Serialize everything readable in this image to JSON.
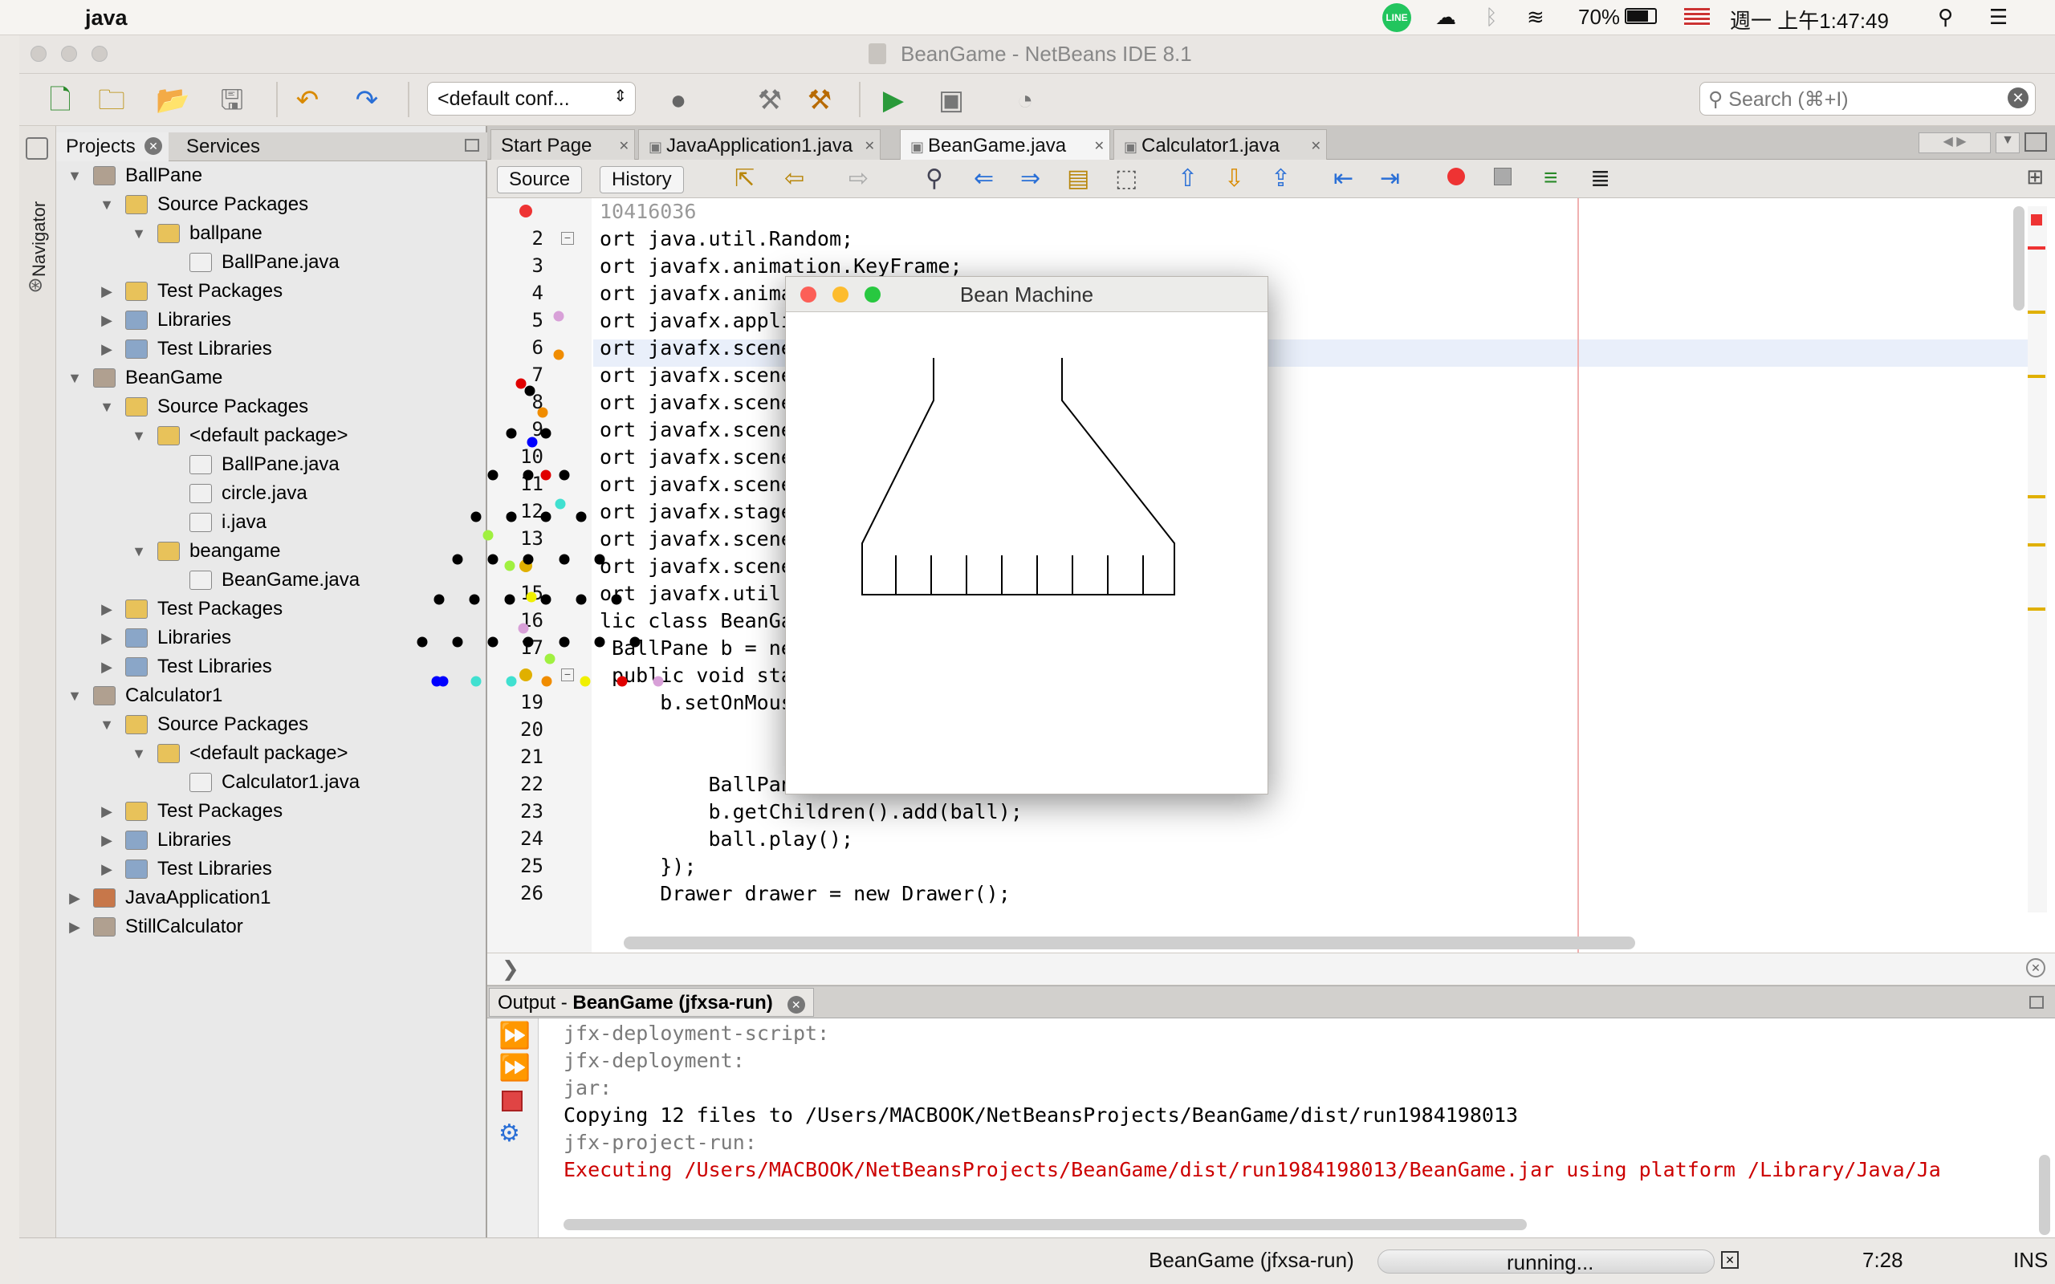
{
  "menubar": {
    "app": "java",
    "battery": "70%",
    "clock": "週一 上午1:47:49"
  },
  "window": {
    "title": "BeanGame - NetBeans IDE 8.1"
  },
  "toolbar": {
    "config": "<default conf...",
    "search_placeholder": "Search (⌘+I)"
  },
  "navigator": {
    "label": "Navigator"
  },
  "projects": {
    "tab_projects": "Projects",
    "tab_services": "Services",
    "tree": [
      {
        "label": "BallPane",
        "depth": 0,
        "icon": "project",
        "open": true
      },
      {
        "label": "Source Packages",
        "depth": 1,
        "icon": "srcpkg",
        "open": true
      },
      {
        "label": "ballpane",
        "depth": 2,
        "icon": "package",
        "open": true
      },
      {
        "label": "BallPane.java",
        "depth": 3,
        "icon": "java"
      },
      {
        "label": "Test Packages",
        "depth": 1,
        "icon": "srcpkg",
        "open": false
      },
      {
        "label": "Libraries",
        "depth": 1,
        "icon": "library",
        "open": false
      },
      {
        "label": "Test Libraries",
        "depth": 1,
        "icon": "library",
        "open": false
      },
      {
        "label": "BeanGame",
        "depth": 0,
        "icon": "project",
        "open": true
      },
      {
        "label": "Source Packages",
        "depth": 1,
        "icon": "srcpkg",
        "open": true
      },
      {
        "label": "<default package>",
        "depth": 2,
        "icon": "package",
        "open": true
      },
      {
        "label": "BallPane.java",
        "depth": 3,
        "icon": "java"
      },
      {
        "label": "circle.java",
        "depth": 3,
        "icon": "java"
      },
      {
        "label": "i.java",
        "depth": 3,
        "icon": "java"
      },
      {
        "label": "beangame",
        "depth": 2,
        "icon": "package",
        "open": true
      },
      {
        "label": "BeanGame.java",
        "depth": 3,
        "icon": "java"
      },
      {
        "label": "Test Packages",
        "depth": 1,
        "icon": "srcpkg",
        "open": false
      },
      {
        "label": "Libraries",
        "depth": 1,
        "icon": "library",
        "open": false
      },
      {
        "label": "Test Libraries",
        "depth": 1,
        "icon": "library",
        "open": false
      },
      {
        "label": "Calculator1",
        "depth": 0,
        "icon": "project",
        "open": true
      },
      {
        "label": "Source Packages",
        "depth": 1,
        "icon": "srcpkg",
        "open": true
      },
      {
        "label": "<default package>",
        "depth": 2,
        "icon": "package",
        "open": true
      },
      {
        "label": "Calculator1.java",
        "depth": 3,
        "icon": "java"
      },
      {
        "label": "Test Packages",
        "depth": 1,
        "icon": "srcpkg",
        "open": false
      },
      {
        "label": "Libraries",
        "depth": 1,
        "icon": "library",
        "open": false
      },
      {
        "label": "Test Libraries",
        "depth": 1,
        "icon": "library",
        "open": false
      },
      {
        "label": "JavaApplication1",
        "depth": 0,
        "icon": "coffee",
        "open": false
      },
      {
        "label": "StillCalculator",
        "depth": 0,
        "icon": "project",
        "open": false
      }
    ]
  },
  "editor": {
    "tabs": [
      "Start Page",
      "JavaApplication1.java",
      "BeanGame.java",
      "Calculator1.java"
    ],
    "active_tab": "BeanGame.java",
    "source_btn": "Source",
    "history_btn": "History",
    "lines": [
      {
        "n": "",
        "t": "10416036",
        "c": "#999"
      },
      {
        "n": "2",
        "t": "ort java.util.Random;"
      },
      {
        "n": "3",
        "t": "ort javafx.animation.KeyFrame;"
      },
      {
        "n": "4",
        "t": "ort javafx.animation.Timeline;"
      },
      {
        "n": "5",
        "t": "ort javafx.application.Application;"
      },
      {
        "n": "6",
        "t": "ort javafx.scene.Scene;"
      },
      {
        "n": "7",
        "t": "ort javafx.scene.layout.Pane;"
      },
      {
        "n": "8",
        "t": "ort javafx.scene.paint.Color;"
      },
      {
        "n": "9",
        "t": "ort javafx.scene.shape.Circle;"
      },
      {
        "n": "10",
        "t": "ort javafx.scene.shape.Line;"
      },
      {
        "n": "11",
        "t": "ort javafx.scene.shape.Polyline;"
      },
      {
        "n": "12",
        "t": "ort javafx.stage.Stage;"
      },
      {
        "n": "13",
        "t": "ort javafx.scene.input.MouseEvent;"
      },
      {
        "n": "",
        "t": "ort javafx.scene.layout.StackPane;"
      },
      {
        "n": "15",
        "t": "ort javafx.util.Duration;"
      },
      {
        "n": "16",
        "t": "lic class BeanGame extends Application {"
      },
      {
        "n": "17",
        "t": " BallPane b = new BallPane();"
      },
      {
        "n": "",
        "t": " public void start(Stage primaryStage) {"
      },
      {
        "n": "19",
        "t": "     b.setOnMouseClicked(e -> {"
      },
      {
        "n": "20",
        "t": ""
      },
      {
        "n": "21",
        "t": ""
      },
      {
        "n": "22",
        "t": "         BallPane ball = new BallPane();"
      },
      {
        "n": "23",
        "t": "         b.getChildren().add(ball);"
      },
      {
        "n": "24",
        "t": "         ball.play();"
      },
      {
        "n": "25",
        "t": "     });"
      },
      {
        "n": "26",
        "t": "     Drawer drawer = new Drawer();"
      }
    ]
  },
  "output": {
    "tab": "Output - ",
    "tab_bold": "BeanGame (jfxsa-run)",
    "lines": [
      {
        "t": "jfx-deployment-script:",
        "c": "#7a7a7a"
      },
      {
        "t": "jfx-deployment:",
        "c": "#7a7a7a"
      },
      {
        "t": "jar:",
        "c": "#7a7a7a"
      },
      {
        "t": "Copying 12 files to /Users/MACBOOK/NetBeansProjects/BeanGame/dist/run1984198013",
        "c": "#000000"
      },
      {
        "t": "jfx-project-run:",
        "c": "#7a7a7a"
      },
      {
        "t": "Executing /Users/MACBOOK/NetBeansProjects/BeanGame/dist/run1984198013/BeanGame.jar using platform /Library/Java/Ja",
        "c": "#cc0000"
      }
    ]
  },
  "status": {
    "task": "BeanGame (jfxsa-run)",
    "progress": "running...",
    "position": "7:28",
    "mode": "INS"
  },
  "bean_machine": {
    "title": "Bean Machine"
  },
  "colors": {
    "accent": "#2f6fd6",
    "error": "#cc0000"
  }
}
